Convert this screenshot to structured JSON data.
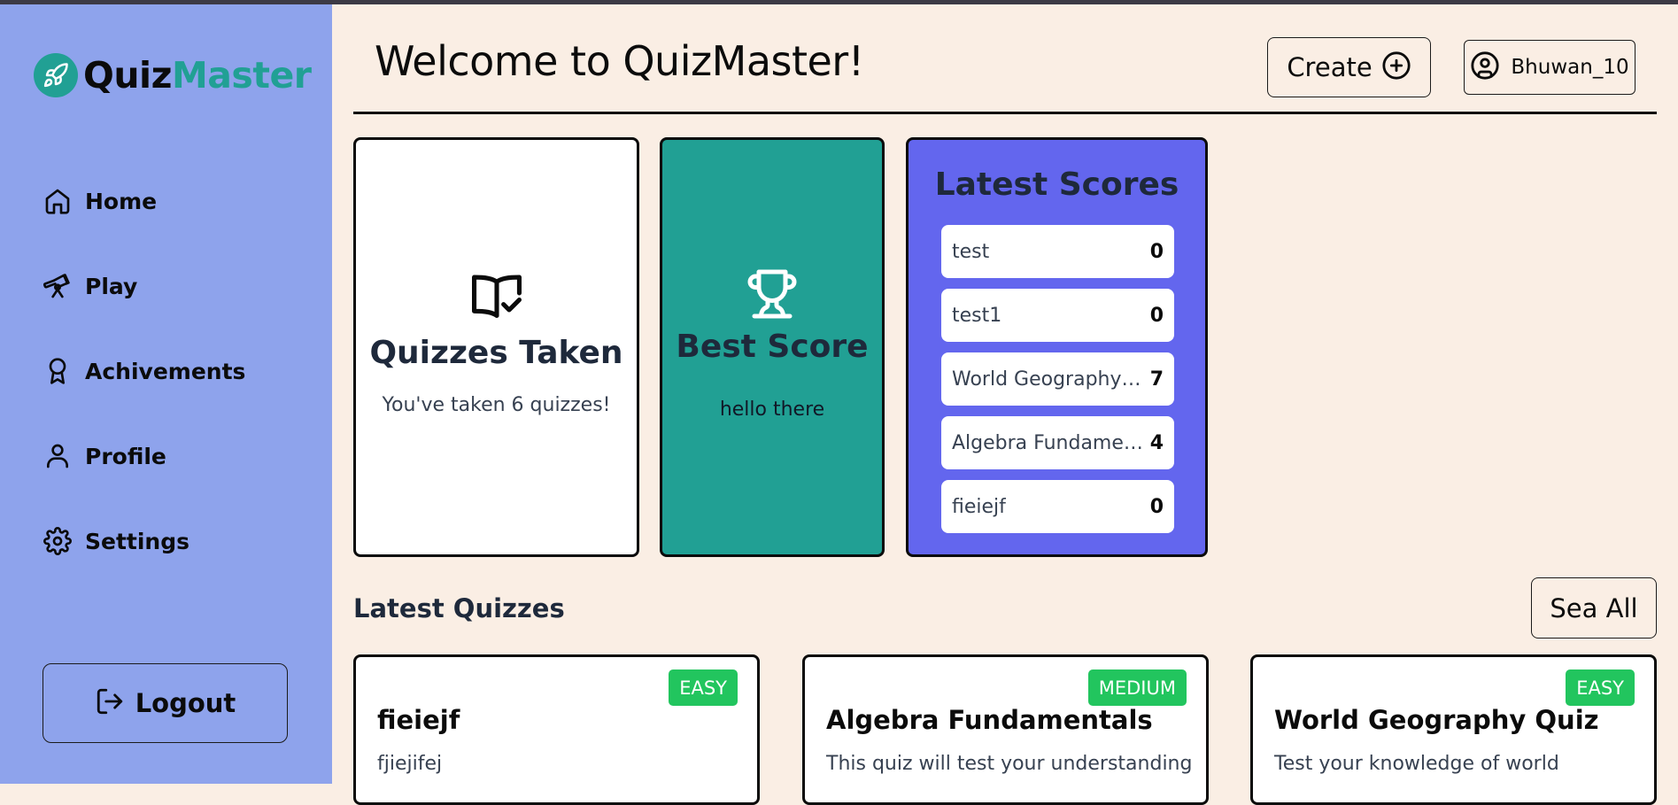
{
  "app": {
    "name_part1": "Quiz",
    "name_part2": "Master",
    "accent": "#21a094",
    "sidebar_bg": "#8ea3ec",
    "page_bg": "#faeee4"
  },
  "sidebar": {
    "items": [
      {
        "label": "Home",
        "icon": "home-icon"
      },
      {
        "label": "Play",
        "icon": "telescope-icon"
      },
      {
        "label": "Achivements",
        "icon": "award-icon"
      },
      {
        "label": "Profile",
        "icon": "user-icon"
      },
      {
        "label": "Settings",
        "icon": "gear-icon"
      }
    ],
    "logout_label": "Logout"
  },
  "header": {
    "title": "Welcome to QuizMaster!",
    "create_label": "Create",
    "username": "Bhuwan_10"
  },
  "stats": {
    "quizzes_taken": {
      "title": "Quizzes Taken",
      "text": "You've taken 6 quizzes!",
      "icon": "book-check-icon"
    },
    "best_score": {
      "title": "Best Score",
      "text": "hello there",
      "icon": "trophy-icon",
      "color": "#21a094"
    },
    "latest_scores": {
      "title": "Latest Scores",
      "color": "#6366ee",
      "items": [
        {
          "name": "test",
          "score": "0"
        },
        {
          "name": "test1",
          "score": "0"
        },
        {
          "name": "World Geography Quiz",
          "score": "7"
        },
        {
          "name": "Algebra Fundamentals",
          "score": "4"
        },
        {
          "name": "fieiejf",
          "score": "0"
        }
      ]
    }
  },
  "latest_quizzes": {
    "title": "Latest Quizzes",
    "see_all_label": "Sea All",
    "items": [
      {
        "title": "fieiejf",
        "desc": "fjiejifej",
        "difficulty": "EASY"
      },
      {
        "title": "Algebra Fundamentals",
        "desc": "This quiz will test your understanding",
        "difficulty": "MEDIUM"
      },
      {
        "title": "World Geography Quiz",
        "desc": "Test your knowledge of world",
        "difficulty": "EASY"
      }
    ],
    "badge_color": "#22c55e"
  }
}
